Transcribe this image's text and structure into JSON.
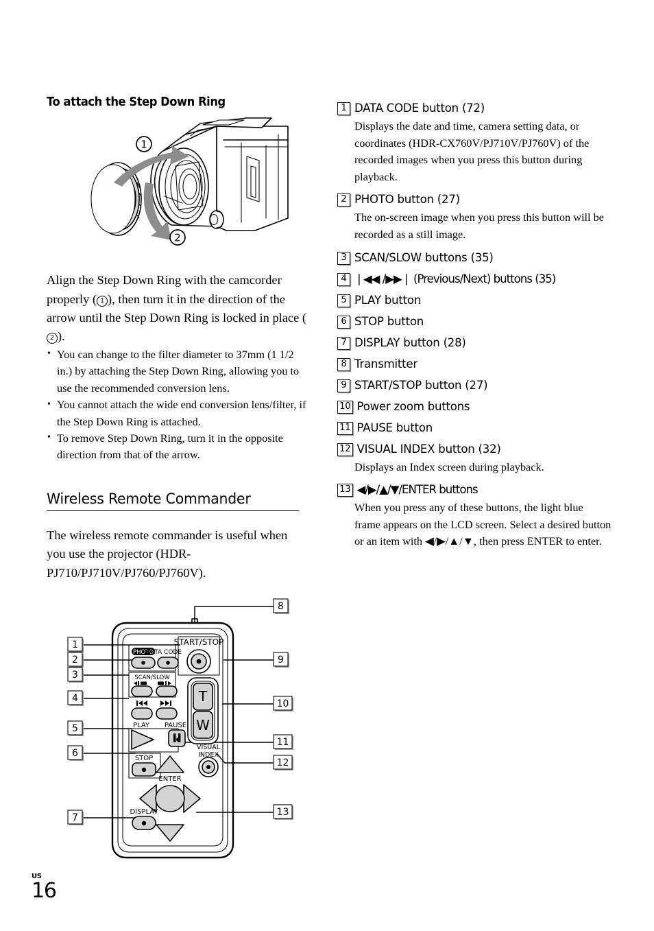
{
  "page": {
    "number": "16",
    "region_code": "US"
  },
  "left_column": {
    "subheading": "To attach the Step Down Ring",
    "figure_camcorder": {
      "name": "step-down-ring-attachment-illustration",
      "callout_1": "1",
      "callout_2": "2"
    },
    "instruction_parts": {
      "p1": "Align the Step Down Ring with the camcorder properly (",
      "c1": "1",
      "p2": "), then turn it in the direction of the arrow until the Step Down Ring is locked in place (",
      "c2": "2",
      "p3": ")."
    },
    "bullets": [
      "You can change to the filter diameter to 37mm  (1 1/2 in.) by attaching the Step Down Ring, allowing you to use the recommended conversion lens.",
      "You cannot attach the wide end conversion lens/filter, if the Step Down Ring is attached.",
      "To remove Step Down Ring, turn it in the opposite direction from that of the arrow."
    ],
    "section_heading": "Wireless Remote Commander",
    "section_paragraph": "The wireless remote commander is useful when you use the projector (HDR-PJ710/PJ710V/PJ760/PJ760V)."
  },
  "remote_figure": {
    "name": "wireless-remote-commander-diagram",
    "labels": {
      "start_stop": "START/STOP",
      "photo": "PHOTO",
      "data_code": "DATA CODE",
      "scan_slow": "SCAN/SLOW",
      "play": "PLAY",
      "pause": "PAUSE",
      "stop": "STOP",
      "display": "DISPLAY",
      "visual": "VISUAL",
      "index": "INDEX",
      "enter": "ENTER",
      "zoom_t": "T",
      "zoom_w": "W"
    },
    "callouts_left": [
      "1",
      "2",
      "3",
      "4",
      "5",
      "6",
      "7"
    ],
    "callouts_right": [
      "8",
      "9",
      "10",
      "11",
      "12",
      "13"
    ]
  },
  "right_column": {
    "items": [
      {
        "num": "1",
        "title": "DATA CODE button (72)",
        "desc": "Displays the date and time, camera setting data, or coordinates (HDR-CX760V/PJ710V/PJ760V) of the recorded images when you press this button during playback."
      },
      {
        "num": "2",
        "title": "PHOTO button (27)",
        "desc": "The on-screen image when you press this button will be recorded as a still image."
      },
      {
        "num": "3",
        "title": "SCAN/SLOW buttons (35)",
        "desc": ""
      },
      {
        "num": "4",
        "title": "❘◀◀ /▶▶❘ (Previous/Next) buttons (35)",
        "desc": ""
      },
      {
        "num": "5",
        "title": "PLAY button",
        "desc": ""
      },
      {
        "num": "6",
        "title": "STOP button",
        "desc": ""
      },
      {
        "num": "7",
        "title": "DISPLAY button (28)",
        "desc": ""
      },
      {
        "num": "8",
        "title": "Transmitter",
        "desc": ""
      },
      {
        "num": "9",
        "title": "START/STOP button (27)",
        "desc": ""
      },
      {
        "num": "10",
        "title": "Power zoom buttons",
        "desc": ""
      },
      {
        "num": "11",
        "title": "PAUSE button",
        "desc": ""
      },
      {
        "num": "12",
        "title": "VISUAL INDEX button (32)",
        "desc": "Displays an Index screen during playback."
      },
      {
        "num": "13",
        "title": "◀/▶/▲/▼/ENTER buttons",
        "desc": "When you press any of these buttons, the light blue frame appears on the LCD screen. Select a desired button or an item with ◀/▶/▲/▼, then press ENTER to enter."
      }
    ]
  },
  "colors": {
    "text": "#000000",
    "rule": "#000000",
    "arrow_gray": "#8d8d8d",
    "button_gray": "#d4d4d4",
    "box_shadow": "#9a9a9a"
  }
}
